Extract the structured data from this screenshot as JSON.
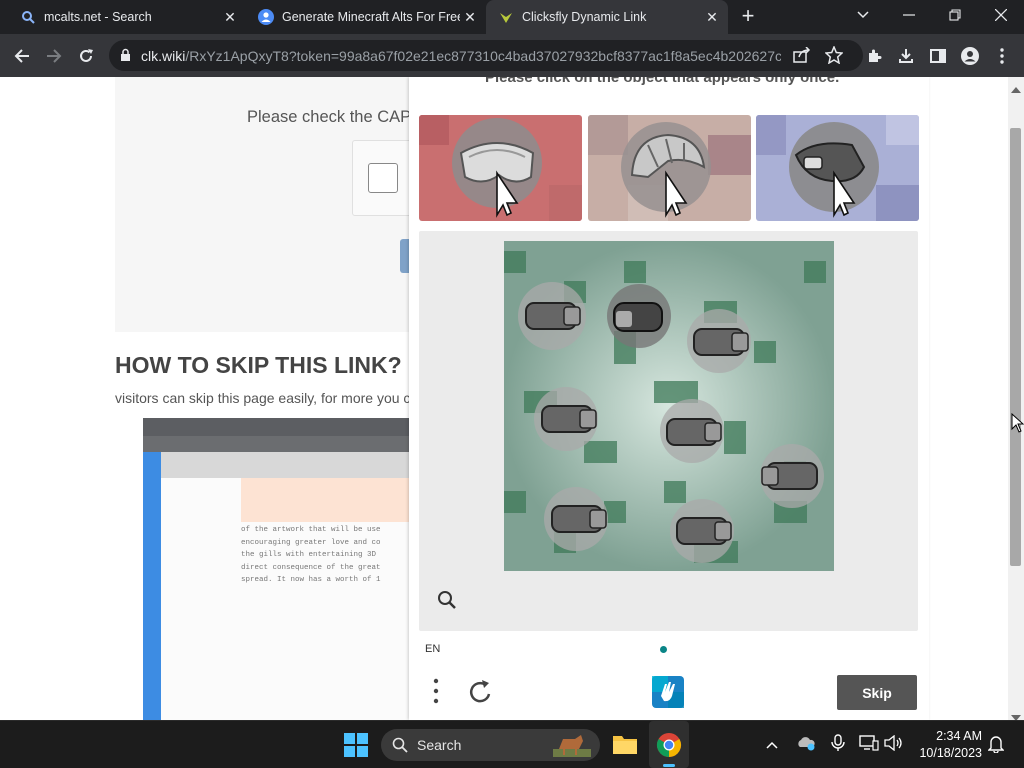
{
  "tabs": [
    {
      "title": "mcalts.net - Search",
      "close": "✕",
      "favicon": "search-icon"
    },
    {
      "title": "Generate Minecraft Alts For Free",
      "close": "✕",
      "favicon": "user-icon"
    },
    {
      "title": "Clicksfly Dynamic Link",
      "close": "✕",
      "favicon": "clicksfly-icon"
    }
  ],
  "new_tab_label": "+",
  "address_bar": {
    "host": "clk.wiki",
    "path": "/RxYz1ApQxyT8?token=99a8a67f02e21ec877310c4bad37027932bcf8377ac1f8a5ec4b202627c1..."
  },
  "page": {
    "check_text": "Please check the CAP",
    "skip_heading": "HOW TO SKIP THIS LINK?",
    "skip_desc": "visitors can skip this page easily, for more you c",
    "embedded_text": "of the artwork that will be use\nencouraging greater love and co\nthe gills with entertaining 3D\ndirect consequence of the great\nspread. It now has a worth of 1"
  },
  "captcha": {
    "prompt": "Please click on the object that appears only once.",
    "language": "EN",
    "skip_label": "Skip",
    "example_tiles": [
      "ski-goggles",
      "bicycle-helmet",
      "vr-headset"
    ],
    "grid_objects": 8
  },
  "taskbar": {
    "search_label": "Search",
    "time": "2:34 AM",
    "date": "10/18/2023"
  }
}
